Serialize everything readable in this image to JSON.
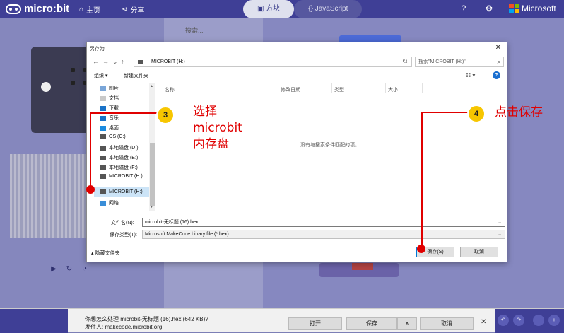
{
  "app": {
    "brand": "micro:bit",
    "nav_home": "主页",
    "nav_share": "分享",
    "mode_blocks": "方块",
    "mode_js": "JavaScript",
    "ms_label": "Microsoft",
    "toolbox_search_placeholder": "搜索..."
  },
  "dialog": {
    "title": "另存为",
    "close": "✕",
    "path": "MICROBIT (H:)",
    "search_placeholder": "搜索\"MICROBIT (H:)\"",
    "toolbar": {
      "organize": "组织 ▾",
      "new_folder": "新建文件夹"
    },
    "nav_items": [
      {
        "label": "图片",
        "icon": "pictures-icon",
        "color": "#7aa6d8"
      },
      {
        "label": "文档",
        "icon": "documents-icon",
        "color": "#c9c9c9"
      },
      {
        "label": "下载",
        "icon": "downloads-icon",
        "color": "#1a73c8"
      },
      {
        "label": "音乐",
        "icon": "music-icon",
        "color": "#1a73c8"
      },
      {
        "label": "桌面",
        "icon": "desktop-icon",
        "color": "#1a8be0"
      },
      {
        "label": "OS (C:)",
        "icon": "drive-icon",
        "color": "#555555"
      },
      {
        "label": "本地磁盘 (D:)",
        "icon": "drive-icon",
        "color": "#555555"
      },
      {
        "label": "本地磁盘 (E:)",
        "icon": "drive-icon",
        "color": "#555555"
      },
      {
        "label": "本地磁盘 (F:)",
        "icon": "drive-icon",
        "color": "#555555"
      },
      {
        "label": "MICROBIT (H:)",
        "icon": "drive-icon",
        "color": "#555555"
      },
      {
        "label": "MICROBIT (H:)",
        "icon": "drive-icon",
        "color": "#555555",
        "selected": true
      },
      {
        "label": "网络",
        "icon": "network-icon",
        "color": "#3a8ed8"
      }
    ],
    "columns": [
      "名称",
      "修改日期",
      "类型",
      "大小"
    ],
    "empty_message": "没有与搜索条件匹配的项。",
    "filename_label": "文件名(N):",
    "filename_value": "microbit-无标题 (16).hex",
    "filetype_label": "保存类型(T):",
    "filetype_value": "Microsoft MakeCode binary file (*.hex)",
    "hide_folders": "隐藏文件夹",
    "save_button": "保存(S)",
    "cancel_button": "取消"
  },
  "annotations": {
    "badge_3": "3",
    "text_3": [
      "选择",
      "microbit",
      "内存盘"
    ],
    "badge_4": "4",
    "text_4": "点击保存",
    "color": "#e00000"
  },
  "download_bar": {
    "question": "你想怎么处理 microbit-无标题 (16).hex (642 KB)?",
    "source": "发件人: makecode.microbit.org",
    "open": "打开",
    "save": "保存",
    "cancel": "取消",
    "close": "✕"
  }
}
